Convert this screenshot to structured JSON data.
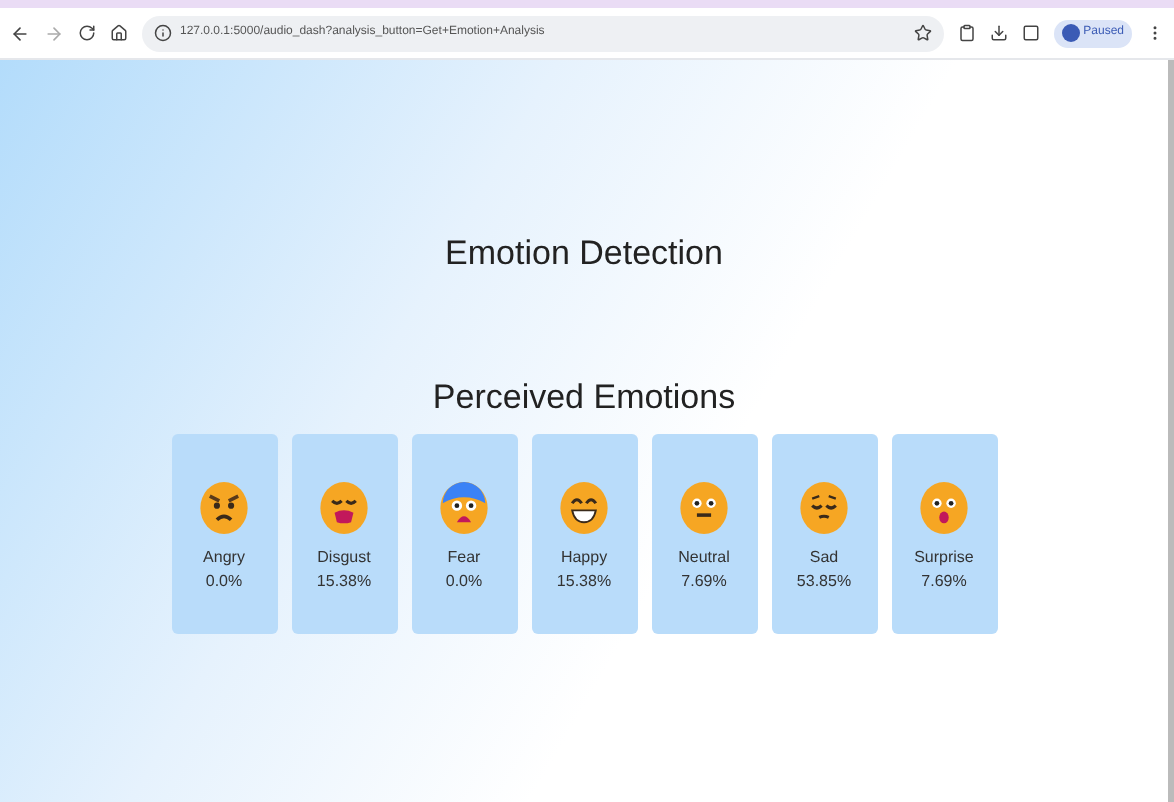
{
  "browser": {
    "url": "127.0.0.1:5000/audio_dash?analysis_button=Get+Emotion+Analysis",
    "profile": "Paused"
  },
  "page": {
    "title": "Emotion Detection",
    "subtitle": "Perceived Emotions"
  },
  "emotions": [
    {
      "kind": "angry",
      "label": "Angry",
      "value": "0.0%"
    },
    {
      "kind": "disgust",
      "label": "Disgust",
      "value": "15.38%"
    },
    {
      "kind": "fear",
      "label": "Fear",
      "value": "0.0%"
    },
    {
      "kind": "happy",
      "label": "Happy",
      "value": "15.38%"
    },
    {
      "kind": "neutral",
      "label": "Neutral",
      "value": "7.69%"
    },
    {
      "kind": "sad",
      "label": "Sad",
      "value": "53.85%"
    },
    {
      "kind": "surprise",
      "label": "Surprise",
      "value": "7.69%"
    }
  ]
}
